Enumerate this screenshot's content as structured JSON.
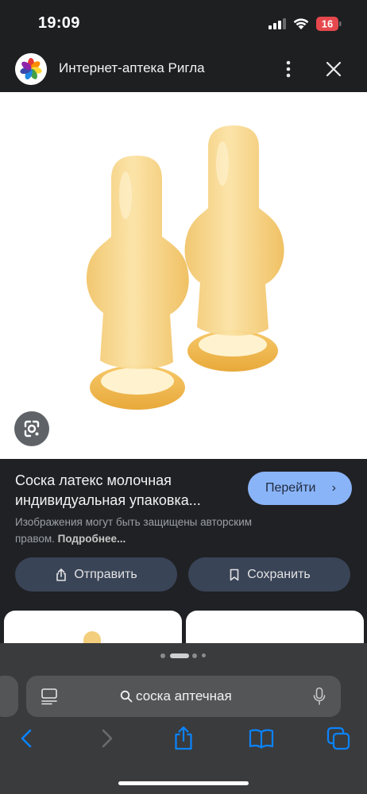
{
  "status_bar": {
    "time": "19:09",
    "battery_level": "16"
  },
  "header": {
    "site_name": "Интернет-аптека Ригла",
    "more_icon": "more-vert-icon",
    "close_icon": "close-icon"
  },
  "image": {
    "lens_icon": "google-lens-icon"
  },
  "info": {
    "title": "Соска латекс молочная индивидуальная упаковка...",
    "go_label": "Перейти",
    "copyright_text": "Изображения могут быть защищены авторским правом.",
    "learn_more_label": "Подробнее...",
    "share_label": "Отправить",
    "save_label": "Сохранить"
  },
  "safari": {
    "address_text": "соска аптечная",
    "toolbar_icons": [
      "back-icon",
      "forward-icon",
      "share-icon",
      "bookmarks-icon",
      "tabs-icon"
    ]
  },
  "colors": {
    "accent": "#8ab4f8",
    "secondary_button": "#394457",
    "safari_blue": "#0a84ff",
    "battery_low": "#e5484d"
  }
}
